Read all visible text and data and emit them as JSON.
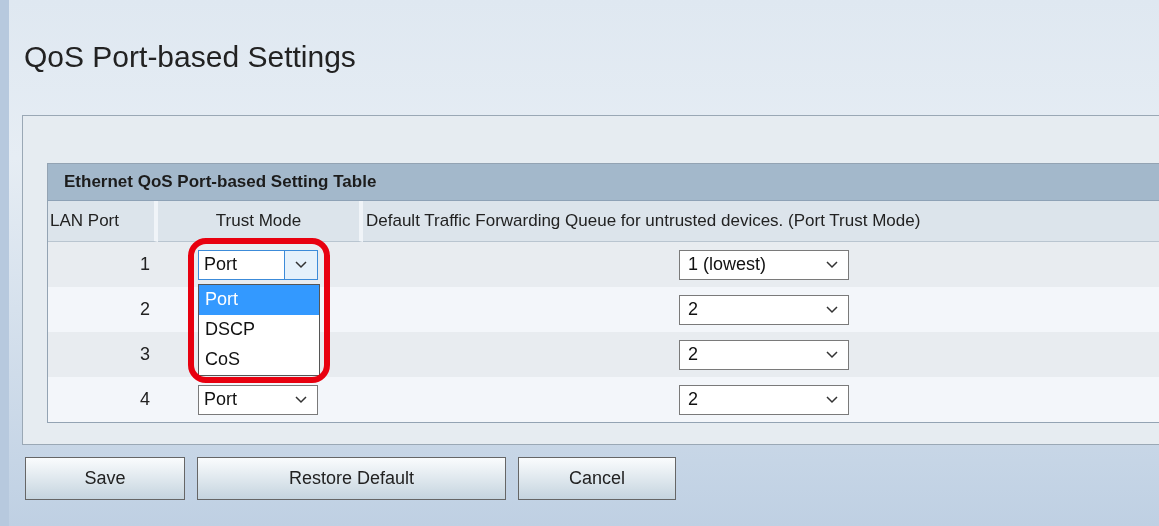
{
  "page_title": "QoS Port-based Settings",
  "table": {
    "title": "Ethernet QoS Port-based Setting Table",
    "columns": [
      "LAN Port",
      "Trust Mode",
      "Default Traffic Forwarding Queue for untrusted devices. (Port Trust Mode)"
    ],
    "rows": [
      {
        "port": "1",
        "trust_mode": "Port",
        "queue": "1 (lowest)",
        "dropdown_open": true
      },
      {
        "port": "2",
        "queue": "2"
      },
      {
        "port": "3",
        "queue": "2"
      },
      {
        "port": "4",
        "trust_mode": "Port",
        "queue": "2",
        "dropdown_open": false
      }
    ]
  },
  "open_dropdown": {
    "options": [
      {
        "label": "Port",
        "selected": true
      },
      {
        "label": "DSCP",
        "selected": false
      },
      {
        "label": "CoS",
        "selected": false
      }
    ]
  },
  "buttons": [
    "Save",
    "Restore Default",
    "Cancel"
  ]
}
